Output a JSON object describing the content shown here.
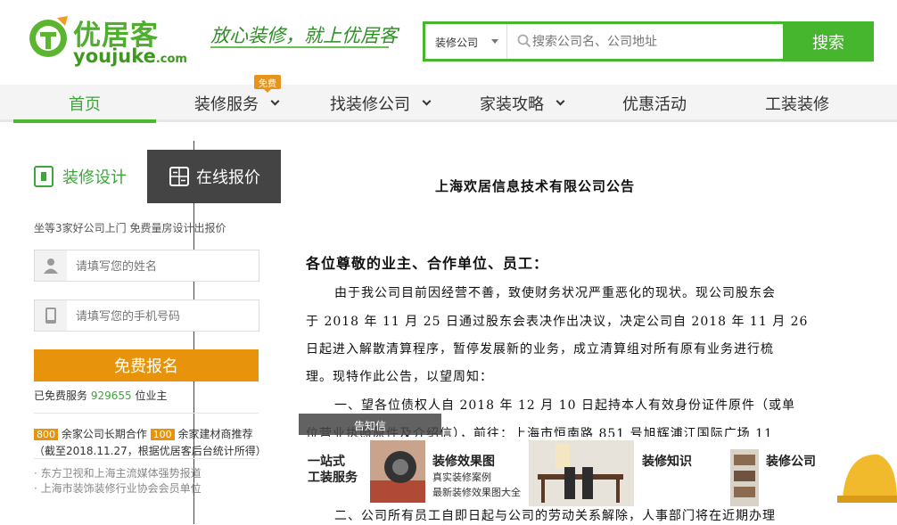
{
  "header": {
    "logo_cn": "优居客",
    "logo_en": "youjuke",
    "logo_en_suffix": ".com",
    "slogan": "放心装修，就上优居客"
  },
  "search": {
    "category": "装修公司",
    "placeholder": "搜索公司名、公司地址",
    "button": "搜索"
  },
  "nav": {
    "items": [
      {
        "label": "首页"
      },
      {
        "label": "装修服务"
      },
      {
        "label": "找装修公司"
      },
      {
        "label": "家装攻略"
      },
      {
        "label": "优惠活动"
      },
      {
        "label": "工装装修"
      }
    ],
    "free_badge": "免费"
  },
  "left_panel": {
    "tab_design": "装修设计",
    "tab_quote": "在线报价",
    "tip": "坐等3家好公司上门 免费量房设计出报价",
    "name_placeholder": "请填写您的姓名",
    "phone_placeholder": "请填写您的手机号码",
    "signup_button": "免费报名",
    "served_prefix": "已免费服务",
    "served_count": "929655",
    "served_suffix": "位业主",
    "stat_companies": "800",
    "stat_companies_text": "余家公司长期合作",
    "stat_brands": "100",
    "stat_brands_text": "余家建材商推荐",
    "stat_note": "（截至2018.11.27，根据优居客后台统计所得）",
    "partners": [
      "· 东方卫视和上海主流媒体强势报道",
      "· 上海市装饰装修行业协会会员单位"
    ]
  },
  "notice": {
    "title": "上海欢居信息技术有限公司公告",
    "greeting": "各位尊敬的业主、合作单位、员工：",
    "lines": [
      "由于我公司目前因经营不善，致使财务状况严重恶化的现状。现公司股东会",
      "于 2018 年 11 月 25 日通过股东会表决作出决议，决定公司自 2018 年 11 月 26",
      "日起进入解散清算程序，暂停发展新的业务，成立清算组对所有原有业务进行梳",
      "理。现特作此公告，以望周知：",
      "一、望各位债权人自 2018 年 12 月 10 日起持本人有效身份证件原件（或单",
      "位营业执照原件及介绍信），前往：上海市恒南路 851 号旭辉浦江国际广场 11",
      "二、公司所有员工自即日起与公司的劳动关系解除，人事部门将在近期办理"
    ],
    "tooltip": "告知信"
  },
  "band": {
    "one_stop_title": "一站式",
    "one_stop_sub": "工装服务",
    "effects_title": "装修效果图",
    "effects_sub1": "真实装修案例",
    "effects_sub2": "最新装修效果图大全",
    "knowledge_title": "装修知识",
    "company_title": "装修公司"
  },
  "colors": {
    "brand_green": "#45b62d",
    "accent_orange": "#e8930c",
    "dark_tab": "#444444"
  }
}
